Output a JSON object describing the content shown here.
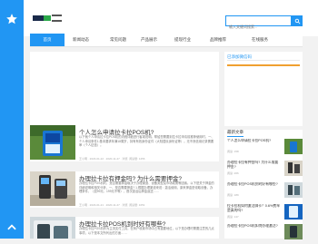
{
  "search": {
    "placeholder": "输入关键词搜索..."
  },
  "nav": [
    {
      "label": "首页",
      "active": true
    },
    {
      "label": "新闻动态"
    },
    {
      "label": "常见问题"
    },
    {
      "label": "产品展示"
    },
    {
      "label": "提现行业"
    },
    {
      "label": "品牌推荐"
    },
    {
      "label": "在线服务"
    }
  ],
  "sidebar_card": {
    "title": "已添加微信码"
  },
  "articles": [
    {
      "title": "个人怎么申请拉卡拉POS机?",
      "desc": "以下就个人申请拉卡拉POS机的流程详细进行客观说明。帮给您需要到拉卡拉申请前推荐使用时，一、个人申请条件1.基本要求年满18周岁，持有有效身份证件（大陆居民身份证等）。无不良信用记录需要审（个人征信）。",
      "meta": "王小明 · 2023-01-22 · 2020-11-27 · 浏览: 阅读量: 1256"
    },
    {
      "title": "办理拉卡拉有押金吗? 为什么需要押金?",
      "desc": "办理拉卡拉POS机时，是否需要押金取决于办理渠道、设备类型及市场政策等因素。以下是关于押金的详细说明和相关分析，一、是否需要押金? 1.根据办理渠道来说：激活使用，原来押金是领取设备，办理条件，（如99元、199元不等），首次激活后押金返还……",
      "meta": "王小明 · 2023-01-21 · 2020-11-27 · 浏览: 阅读量: 1051"
    },
    {
      "title": "办理拉卡拉POS机到时好有哪些?",
      "desc": "办理拉卡拉POS机作为主流支付工具，在商户收款市场中占有重要地位，以下是办理时需要注意的几点事项，以下是本文所列出的方面……",
      "meta": ""
    }
  ],
  "latest": {
    "title": "最新文章",
    "items": [
      {
        "title": "个人怎么申请拉卡拉POS机?",
        "views": "阅读: 158"
      },
      {
        "title": "办理拉卡拉有押金吗? 为什么需要押金?",
        "views": "阅读: 266"
      },
      {
        "title": "办理拉卡拉POS机到时好有哪些?",
        "views": "阅读: 189"
      },
      {
        "title": "拉卡拉机如何激活绑卡？0.6%费率是真的吗?",
        "views": "阅读: 147"
      },
      {
        "title": "办理拉卡拉POS机如何办理激活?",
        "views": "阅读: 97"
      }
    ]
  },
  "colors": {
    "accent": "#2196f3",
    "orange": "#f0a030"
  }
}
